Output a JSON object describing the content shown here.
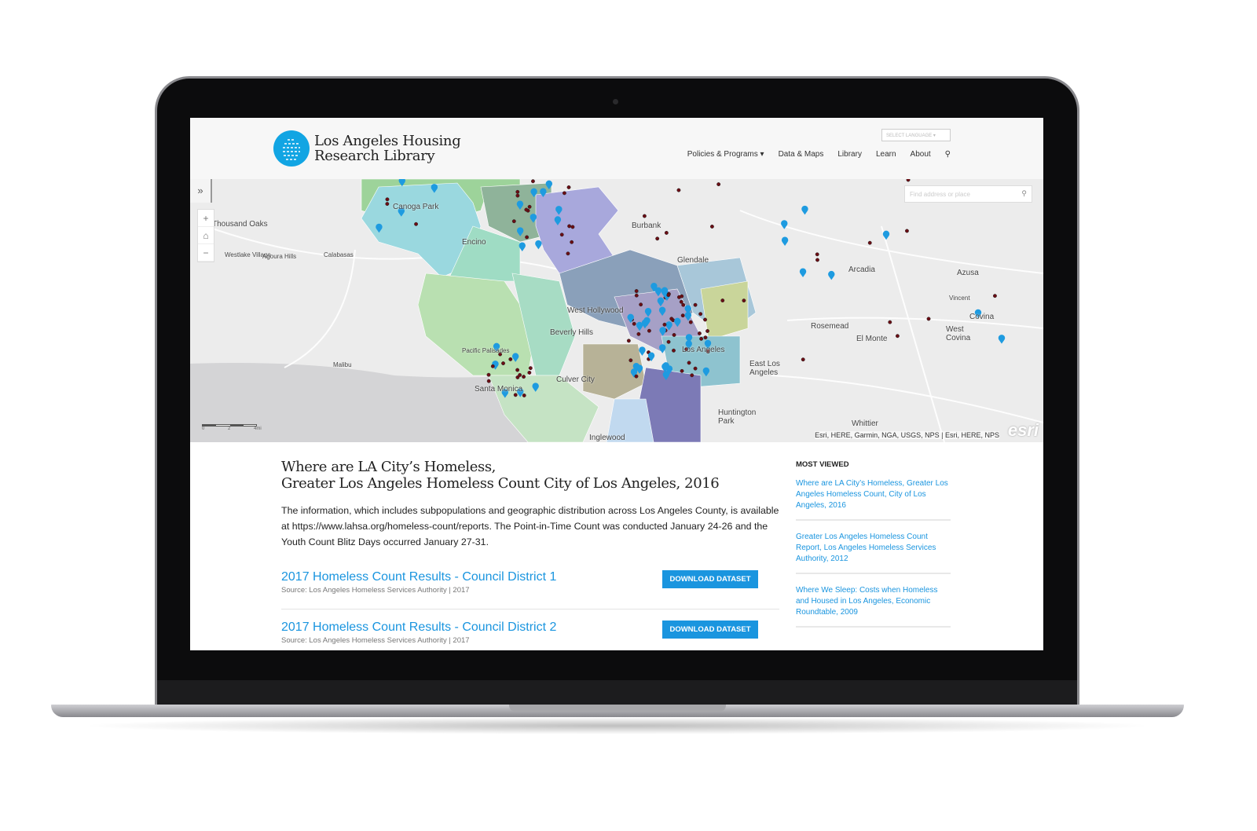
{
  "site": {
    "title_line1": "Los Angeles Housing",
    "title_line2": "Research Library",
    "brand_color": "#12a5e3"
  },
  "header": {
    "language_select": "SELECT LANGUAGE",
    "nav": [
      {
        "label": "Policies & Programs ▾"
      },
      {
        "label": "Data & Maps"
      },
      {
        "label": "Library"
      },
      {
        "label": "Learn"
      },
      {
        "label": "About"
      }
    ],
    "search_icon": "search-icon"
  },
  "map": {
    "search_placeholder": "Find address or place",
    "attribution": "Esri, HERE, Garmin, NGA, USGS, NPS | Esri, HERE, NPS",
    "logo": "esri",
    "scale": [
      "0",
      "2",
      "4mi"
    ],
    "labels": [
      "Thousand Oaks",
      "Westlake Village",
      "Agoura Hills",
      "Calabasas",
      "Canoga Park",
      "Encino",
      "Burbank",
      "Glendale",
      "Arcadia",
      "Azusa",
      "Vincent",
      "Covina",
      "West Covina",
      "El Monte",
      "Rosemead",
      "West Hollywood",
      "Beverly Hills",
      "Pacific Palisades",
      "Malibu",
      "Santa Monica",
      "Culver City",
      "Los Angeles",
      "East Los Angeles",
      "Huntington Park",
      "Inglewood",
      "Whittier"
    ],
    "colors": {
      "pin": "#1e9be0",
      "dot": "#6b0d14"
    }
  },
  "article": {
    "title_line1": "Where are LA City’s Homeless,",
    "title_line2": "Greater Los Angeles Homeless Count City of Los Angeles, 2016",
    "description": "The information, which includes subpopulations and geographic distribution across Los Angeles County, is available at https://www.lahsa.org/homeless-count/reports. The Point-in-Time Count was conducted January 24-26 and the Youth Count Blitz Days occurred January 27-31.",
    "datasets": [
      {
        "title": "2017 Homeless Count Results - Council District 1",
        "source": "Source: Los Angeles Homeless Services Authority | 2017",
        "button": "DOWNLOAD DATASET"
      },
      {
        "title": "2017 Homeless Count Results - Council District 2",
        "source": "Source: Los Angeles Homeless Services Authority | 2017",
        "button": "DOWNLOAD DATASET"
      }
    ]
  },
  "sidebar": {
    "heading": "MOST VIEWED",
    "items": [
      {
        "label": "Where are LA City’s Homeless, Greater Los Angeles Homeless Count, City of Los Angeles, 2016"
      },
      {
        "label": "Greater Los Angeles Homeless Count Report, Los Angeles Homeless Services Authority, 2012"
      },
      {
        "label": "Where We Sleep: Costs when Homeless and Housed in Los Angeles, Economic Roundtable, 2009"
      }
    ]
  }
}
